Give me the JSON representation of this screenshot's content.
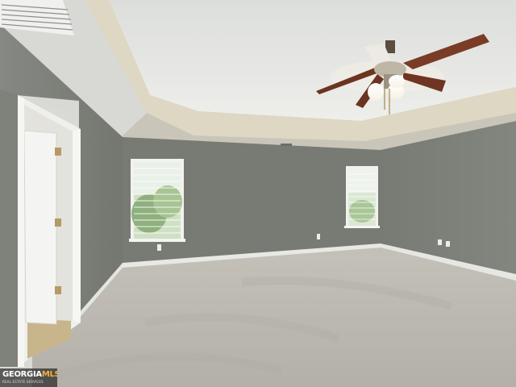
{
  "watermark": {
    "brand_main": "GEORGIA",
    "brand_suffix": "MLS",
    "tagline": "REAL ESTATE SERVICES"
  },
  "colors": {
    "wall": "#7b7d75",
    "wall_right": "#7c8079",
    "ceiling": "#e4e5e1",
    "tray_trim": "#ddd8c6",
    "carpet": "#bcb9b2",
    "baseboard": "#e8e8e4",
    "door": "#f3f3f1",
    "fan_blade": "#7a3c26",
    "brand_accent": "#f3b23a"
  }
}
